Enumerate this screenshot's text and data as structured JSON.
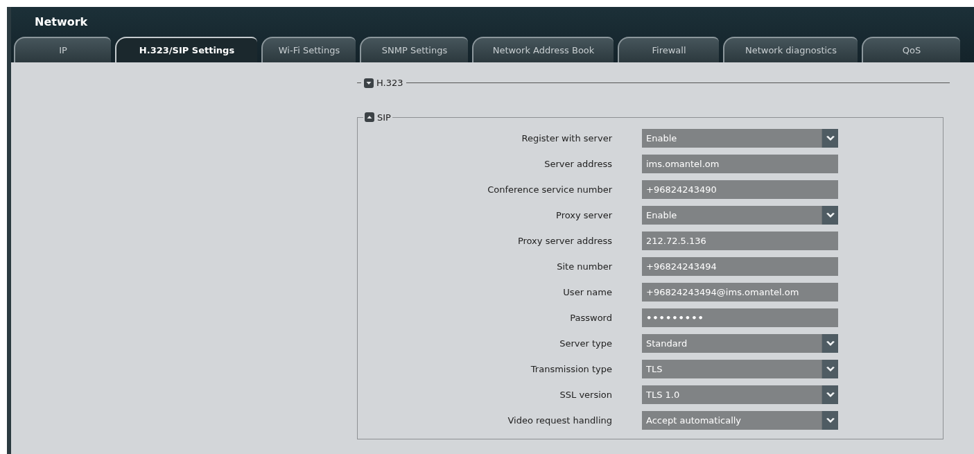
{
  "window": {
    "title": "Network"
  },
  "tabs": [
    {
      "label": "IP",
      "selected": false
    },
    {
      "label": "H.323/SIP Settings",
      "selected": true
    },
    {
      "label": "Wi-Fi Settings",
      "selected": false
    },
    {
      "label": "SNMP Settings",
      "selected": false
    },
    {
      "label": "Network Address Book",
      "selected": false
    },
    {
      "label": "Firewall",
      "selected": false
    },
    {
      "label": "Network diagnostics",
      "selected": false
    },
    {
      "label": "QoS",
      "selected": false
    }
  ],
  "sections": [
    {
      "title": "H.323",
      "expanded": false
    },
    {
      "title": "SIP",
      "expanded": true,
      "fields": [
        {
          "label": "Register with server",
          "kind": "select",
          "value": "Enable"
        },
        {
          "label": "Server address",
          "kind": "text",
          "value": "ims.omantel.om"
        },
        {
          "label": "Conference service number",
          "kind": "text",
          "value": "+96824243490"
        },
        {
          "label": "Proxy server",
          "kind": "select",
          "value": "Enable"
        },
        {
          "label": "Proxy server address",
          "kind": "text",
          "value": "212.72.5.136"
        },
        {
          "label": "Site number",
          "kind": "text",
          "value": "+96824243494"
        },
        {
          "label": "User name",
          "kind": "text",
          "value": "+96824243494@ims.omantel.om"
        },
        {
          "label": "Password",
          "kind": "password",
          "value": "•••••••••"
        },
        {
          "label": "Server type",
          "kind": "select",
          "value": "Standard"
        },
        {
          "label": "Transmission type",
          "kind": "select",
          "value": "TLS"
        },
        {
          "label": "SSL version",
          "kind": "select",
          "value": "TLS 1.0"
        },
        {
          "label": "Video request handling",
          "kind": "select",
          "value": "Accept automatically"
        }
      ]
    }
  ]
}
